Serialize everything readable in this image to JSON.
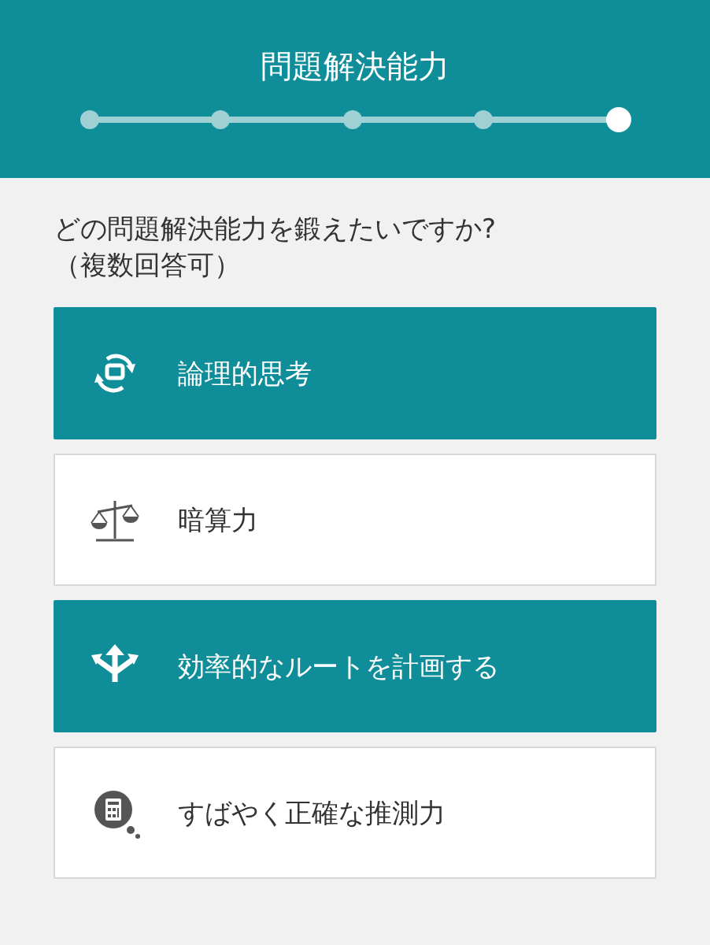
{
  "header": {
    "title": "問題解決能力",
    "steps": [
      {
        "selected": false
      },
      {
        "selected": false
      },
      {
        "selected": false
      },
      {
        "selected": false
      },
      {
        "selected": true
      }
    ]
  },
  "question": {
    "text": "どの問題解決能力を鍛えたいですか?",
    "note": "（複数回答可）"
  },
  "options": [
    {
      "label": "論理的思考",
      "kind": "cycle",
      "selected": true
    },
    {
      "label": "暗算力",
      "kind": "scale",
      "selected": false
    },
    {
      "label": "効率的なルートを計画する",
      "kind": "routes",
      "selected": true
    },
    {
      "label": "すばやく正確な推測力",
      "kind": "calculator",
      "selected": false
    }
  ]
}
